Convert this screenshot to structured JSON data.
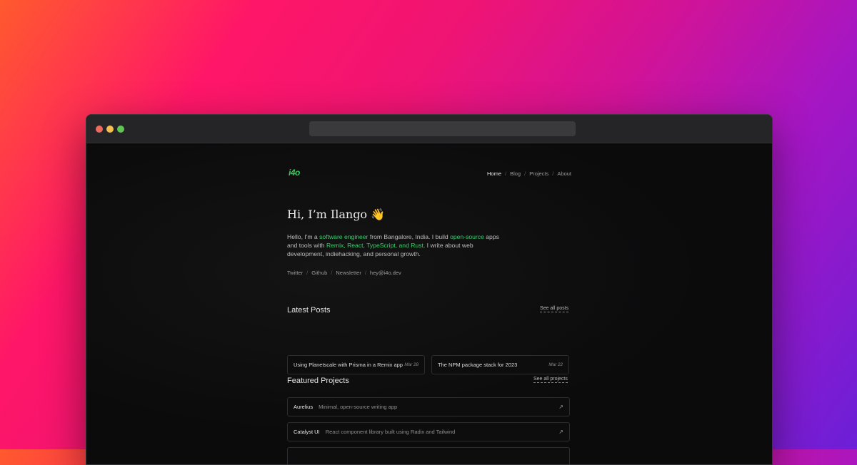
{
  "site": {
    "logo": "i4o",
    "nav": [
      {
        "label": "Home"
      },
      {
        "label": "Blog"
      },
      {
        "label": "Projects"
      },
      {
        "label": "About"
      }
    ],
    "nav_separator": "/"
  },
  "hero": {
    "title": "Hi, I’m Ilango 👋",
    "intro_parts": {
      "p1": "Hello, I'm a ",
      "h1": "software engineer",
      "p2": " from Bangalore, India. I build ",
      "h2": "open-source",
      "p3": " apps and tools with ",
      "h3": "Remix, React, TypeScript, and Rust",
      "p4": ". I write about web development, indiehacking, and personal growth."
    }
  },
  "socials": [
    {
      "label": "Twitter"
    },
    {
      "label": "Github"
    },
    {
      "label": "Newsletter"
    },
    {
      "label": "hey@i4o.dev"
    }
  ],
  "latest_posts": {
    "title": "Latest Posts",
    "see_all": "See all posts",
    "items": [
      {
        "title": "Using Planetscale with Prisma in a Remix app",
        "date": "Mar 28"
      },
      {
        "title": "The NPM package stack for 2023",
        "date": "Mar 22"
      }
    ]
  },
  "featured_projects": {
    "title": "Featured Projects",
    "see_all": "See all projects",
    "items": [
      {
        "name": "Aurelius",
        "description": "Minimal, open-source writing app",
        "icon": "arrow-up-right-icon"
      },
      {
        "name": "Catalyst UI",
        "description": "React component library built using Radix and Tailwind",
        "icon": "arrow-up-right-icon"
      }
    ]
  },
  "colors": {
    "accent": "#34c759",
    "window_bg": "#0b0b0c",
    "titlebar_bg": "#252527"
  }
}
